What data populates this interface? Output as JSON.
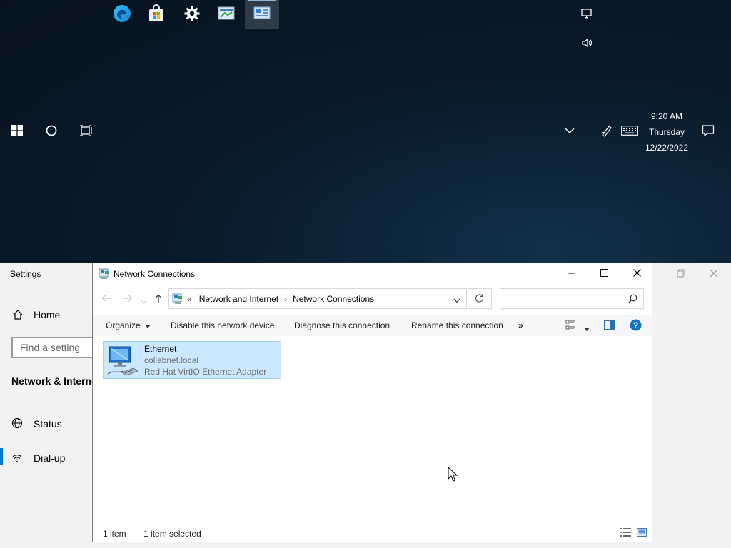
{
  "taskbar": {
    "pinned": [
      {
        "name": "edge-icon",
        "active": false
      },
      {
        "name": "store-icon",
        "active": false
      },
      {
        "name": "settings-gear-icon",
        "active": false
      },
      {
        "name": "control-panel-icon",
        "active": false
      },
      {
        "name": "network-connections-app-icon",
        "active": true
      }
    ],
    "clock": {
      "time": "9:20 AM",
      "day": "Thursday",
      "date": "12/22/2022"
    }
  },
  "settings_window": {
    "title": "Settings",
    "home_label": "Home",
    "search_placeholder": "Find a setting",
    "section_heading": "Network & Internet",
    "nav_items": [
      "Status",
      "Dial-up"
    ]
  },
  "explorer": {
    "title": "Network Connections",
    "breadcrumb": {
      "prefix": "«",
      "parent": "Network and Internet",
      "separator": "›",
      "current": "Network Connections"
    },
    "search_value": "",
    "commands": {
      "organize": "Organize",
      "disable": "Disable this network device",
      "diagnose": "Diagnose this connection",
      "rename": "Rename this connection",
      "more": "»"
    },
    "items": [
      {
        "name": "Ethernet",
        "network": "collabnet.local",
        "adapter": "Red Hat VirtIO Ethernet Adapter",
        "selected": true
      }
    ],
    "status": {
      "count": "1 item",
      "selection": "1 item selected"
    }
  },
  "colors": {
    "accent": "#0078d7",
    "selection_bg": "#cce8ff",
    "selection_border": "#99d1ff"
  }
}
